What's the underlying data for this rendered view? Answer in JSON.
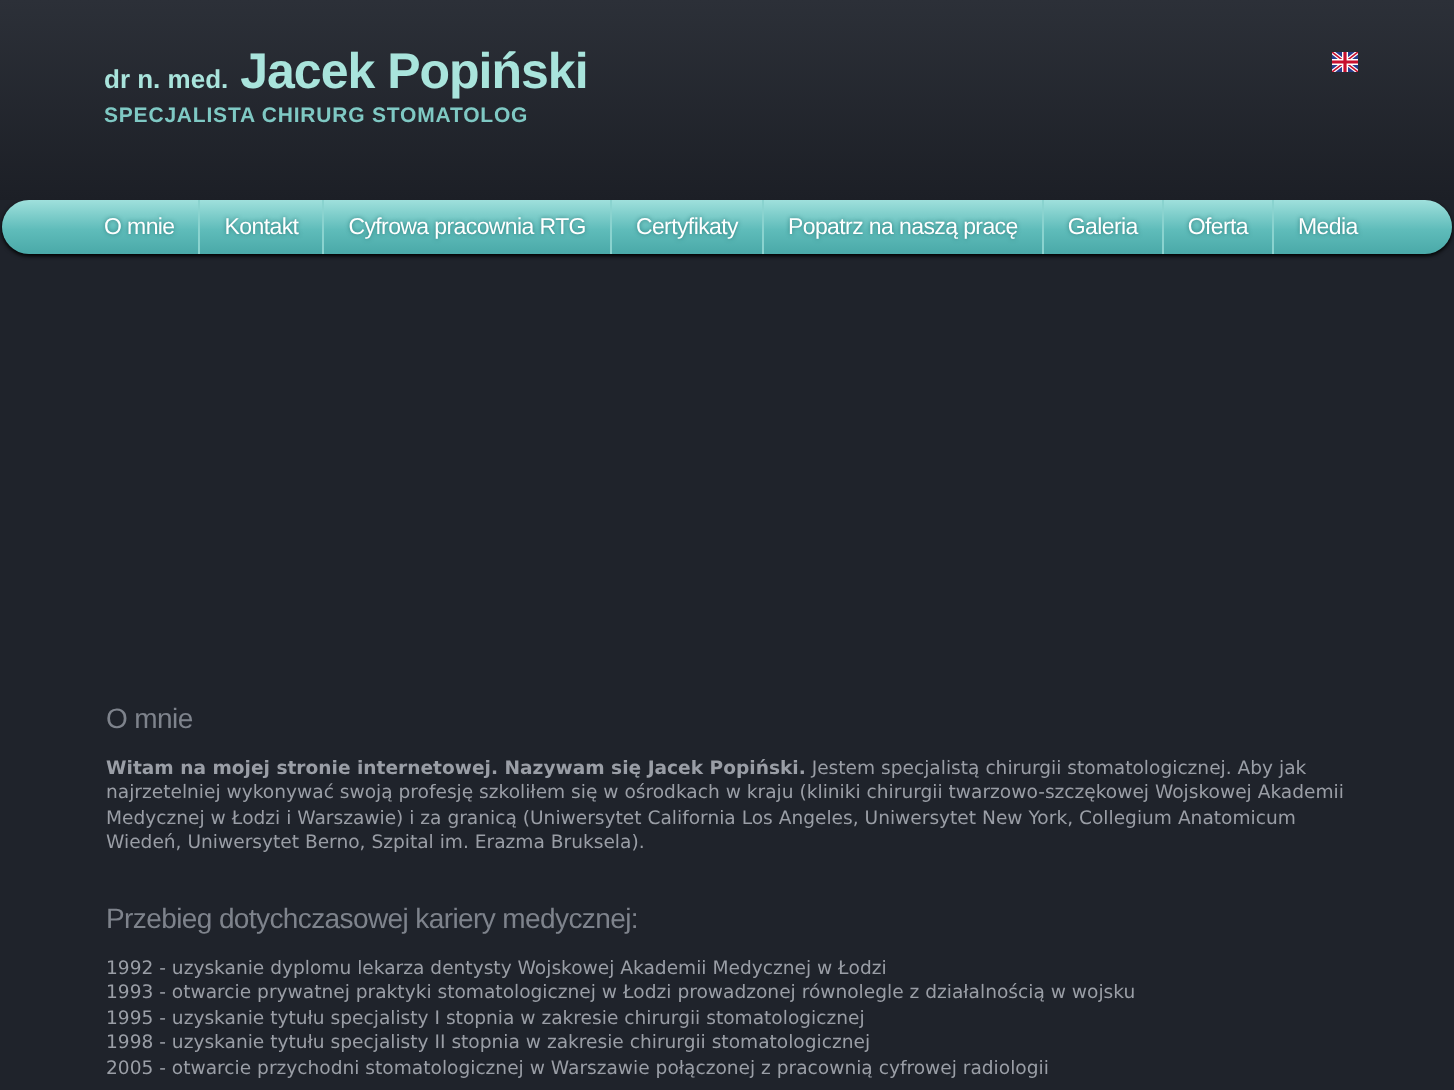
{
  "header": {
    "prefix": "dr n. med.",
    "name": "Jacek Popiński",
    "subtitle": "SPECJALISTA CHIRURG STOMATOLOG"
  },
  "language_flag": {
    "selected": false
  },
  "nav": [
    {
      "label": "O mnie",
      "selected": false
    },
    {
      "label": "Kontakt",
      "selected": false
    },
    {
      "label": "Cyfrowa pracownia RTG",
      "selected": false
    },
    {
      "label": "Certyfikaty",
      "selected": false
    },
    {
      "label": "Popatrz na naszą pracę",
      "selected": false
    },
    {
      "label": "Galeria",
      "selected": false
    },
    {
      "label": "Oferta",
      "selected": false
    },
    {
      "label": "Media",
      "selected": false
    }
  ],
  "content": {
    "title": "O mnie",
    "intro": "**Witam na mojej stronie internetowej. Nazywam się Jacek Popiński.** Jestem specjalistą chirurgii stomatologicznej. Aby jak najrzetelniej wykonywać swoją profesję szkoliłem się w ośrodkach w kraju (kliniki chirurgii twarzowo-szczękowej Wojskowej Akademii Medycznej w Łodzi i Warszawie) i za granicą (Uniwersytet California Los Angeles, Uniwersytet New York, Collegium Anatomicum Wiedeń, Uniwersytet Berno, Szpital im. Erazma Bruksela).",
    "career_title": "Przebieg dotychczasowej kariery medycznej:",
    "career": [
      "1992 - uzyskanie dyplomu lekarza dentysty Wojskowej Akademii Medycznej w Łodzi",
      "1993 - otwarcie prywatnej praktyki stomatologicznej w Łodzi prowadzonej równolegle z działalnością w wojsku",
      "1995 - uzyskanie tytułu specjalisty I stopnia w zakresie chirurgii stomatologicznej",
      "1998 - uzyskanie tytułu specjalisty II stopnia w zakresie chirurgii stomatologicznej",
      "2005 - otwarcie przychodni stomatologicznej w Warszawie połączonej z pracownią cyfrowej radiologii"
    ]
  }
}
